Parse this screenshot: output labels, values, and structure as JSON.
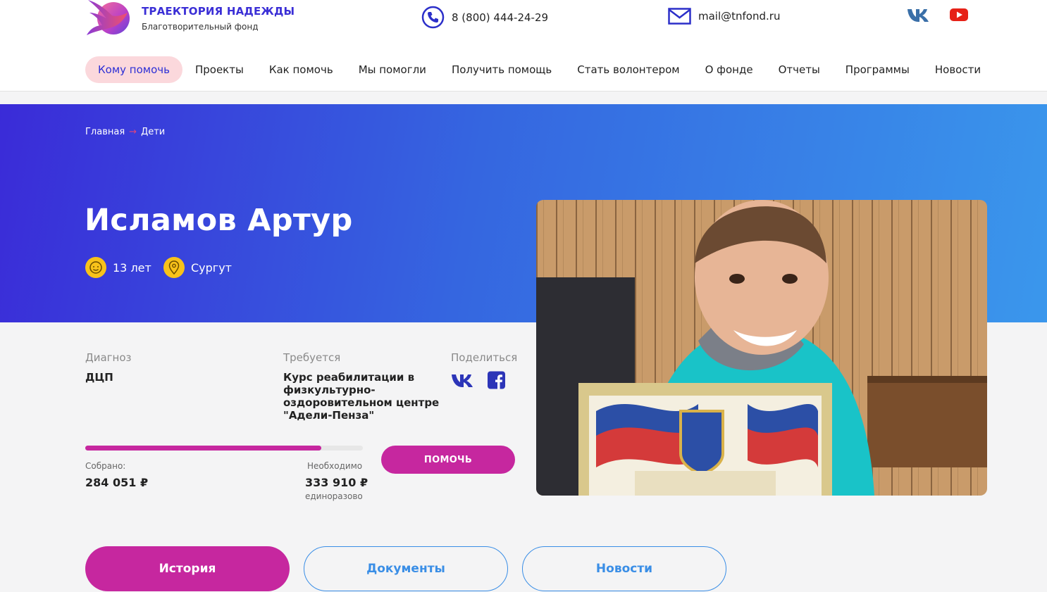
{
  "brand": {
    "name": "ТРАЕКТОРИЯ НАДЕЖДЫ",
    "subtitle": "Благотворительный фонд"
  },
  "contacts": {
    "phone": "8 (800) 444-24-29",
    "email": "mail@tnfond.ru"
  },
  "social_top": [
    "vk-icon",
    "youtube-icon"
  ],
  "nav": [
    {
      "label": "Кому помочь",
      "active": true
    },
    {
      "label": "Проекты"
    },
    {
      "label": "Как помочь"
    },
    {
      "label": "Мы помогли"
    },
    {
      "label": "Получить помощь"
    },
    {
      "label": "Стать волонтером"
    },
    {
      "label": "О фонде"
    },
    {
      "label": "Отчеты"
    },
    {
      "label": "Программы"
    },
    {
      "label": "Новости"
    }
  ],
  "breadcrumb": {
    "home": "Главная",
    "current": "Дети"
  },
  "child": {
    "name": "Исламов Артур",
    "age": "13 лет",
    "city": "Сургут"
  },
  "info": {
    "diagnosis_label": "Диагноз",
    "diagnosis": "ДЦП",
    "needed_label": "Требуется",
    "needed_lines": [
      "Курс реабилитации в",
      "физкультурно-",
      "оздоровительном центре",
      "\"Адели-Пенза\""
    ],
    "share_label": "Поделиться"
  },
  "funding": {
    "collected_label": "Собрано:",
    "collected": "284 051 ₽",
    "needed_label": "Необходимо",
    "needed": "333 910 ₽",
    "note": "единоразово",
    "progress_fraction": 0.85
  },
  "help_button": "ПОМОЧЬ",
  "tabs": [
    "История",
    "Документы",
    "Новости"
  ],
  "colors": {
    "brand_blue": "#3b2fd6",
    "accent": "#c6279f",
    "yellow": "#f8c21a"
  }
}
